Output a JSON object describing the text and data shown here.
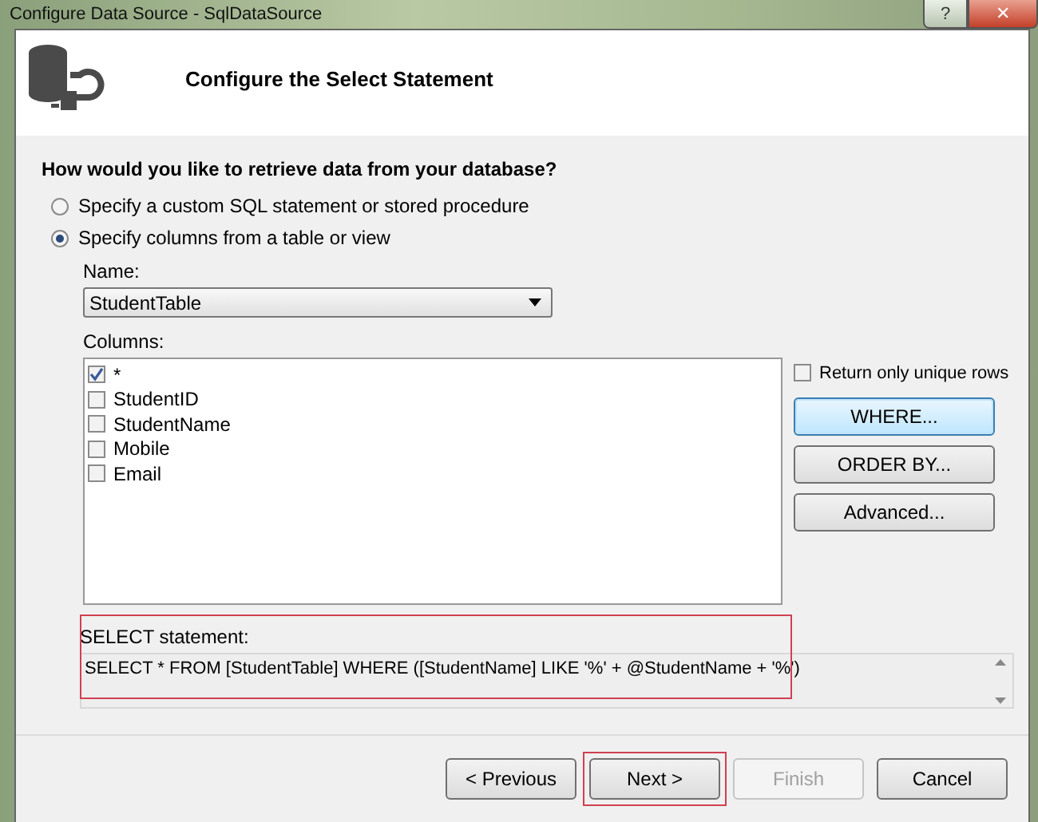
{
  "window": {
    "title": "Configure Data Source - SqlDataSource",
    "controls": [
      {
        "kind": "help",
        "label": "?"
      },
      {
        "kind": "close",
        "label": "✕"
      }
    ]
  },
  "header": {
    "title": "Configure the Select Statement"
  },
  "question": "How would you like to retrieve data from your database?",
  "options": [
    {
      "label": "Specify a custom SQL statement or stored procedure",
      "selected": false
    },
    {
      "label": "Specify columns from a table or view",
      "selected": true
    }
  ],
  "name_label": "Name:",
  "name_value": "StudentTable",
  "columns_label": "Columns:",
  "columns": [
    {
      "label": "*",
      "checked": true
    },
    {
      "label": "StudentID",
      "checked": false
    },
    {
      "label": "StudentName",
      "checked": false
    },
    {
      "label": "Mobile",
      "checked": false
    },
    {
      "label": "Email",
      "checked": false
    }
  ],
  "unique_rows": {
    "label": "Return only unique rows",
    "checked": false
  },
  "side_buttons": [
    {
      "label": "WHERE...",
      "focused": true
    },
    {
      "label": "ORDER BY...",
      "focused": false
    },
    {
      "label": "Advanced...",
      "focused": false
    }
  ],
  "statement": {
    "label": "SELECT statement:",
    "value": "SELECT * FROM [StudentTable] WHERE ([StudentName] LIKE '%' + @StudentName + '%')",
    "highlighted": true
  },
  "footer_buttons": [
    {
      "label": "< Previous",
      "disabled": false,
      "highlighted": false
    },
    {
      "label": "Next >",
      "disabled": false,
      "highlighted": true
    },
    {
      "label": "Finish",
      "disabled": true,
      "highlighted": false
    },
    {
      "label": "Cancel",
      "disabled": false,
      "highlighted": false
    }
  ]
}
